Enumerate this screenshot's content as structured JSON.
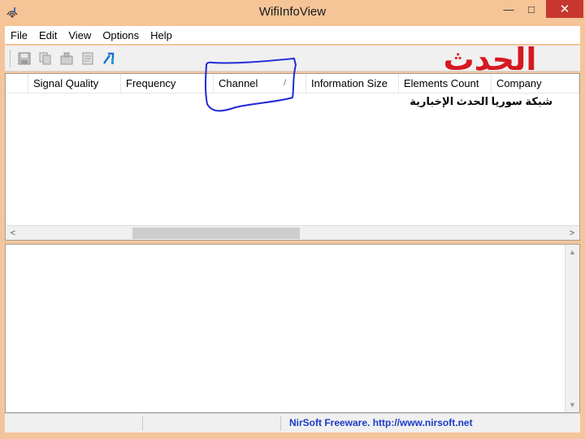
{
  "window": {
    "title": "WifiInfoView",
    "minimize_glyph": "—",
    "maximize_glyph": "□",
    "close_glyph": "✕"
  },
  "menu": {
    "items": [
      "File",
      "Edit",
      "View",
      "Options",
      "Help"
    ]
  },
  "toolbar": {
    "buttons": [
      {
        "icon": "save-icon"
      },
      {
        "icon": "copy-icon"
      },
      {
        "icon": "properties-icon"
      },
      {
        "icon": "report-icon"
      },
      {
        "icon": "exit-icon"
      }
    ]
  },
  "list": {
    "columns": {
      "signal": "Signal Quality",
      "frequency": "Frequency",
      "channel": "Channel",
      "info_size": "Information Size",
      "elements": "Elements Count",
      "company": "Company"
    },
    "sort_indicator": "/"
  },
  "scrollbars": {
    "left_arrow": "<",
    "right_arrow": ">",
    "up_arrow": "▲",
    "down_arrow": "▼"
  },
  "status": {
    "link_text": "NirSoft Freeware.  http://www.nirsoft.net"
  },
  "watermark": {
    "logo_text": "الحدث",
    "caption": "شبكة سوريا الحدث الإخبارية"
  },
  "colors": {
    "titlebar": "#f5c497",
    "close_button": "#c7372f",
    "status_link": "#1a3cc8",
    "annotation": "#1f2bd6",
    "watermark_logo": "#d6181f"
  }
}
